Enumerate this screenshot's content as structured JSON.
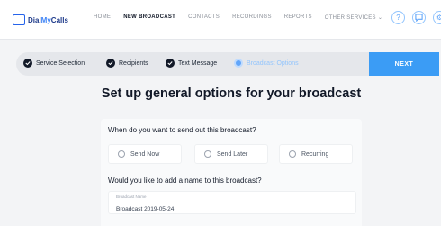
{
  "brand": {
    "logo_text_1": "Dial",
    "logo_text_accent": "My",
    "logo_text_2": "Calls"
  },
  "nav": {
    "items": [
      {
        "label": "HOME"
      },
      {
        "label": "NEW BROADCAST"
      },
      {
        "label": "CONTACTS"
      },
      {
        "label": "RECORDINGS"
      },
      {
        "label": "REPORTS"
      },
      {
        "label": "OTHER SERVICES"
      }
    ],
    "active_index": 1,
    "dropdown_icon": "chevron-down-icon"
  },
  "header_icons": [
    "help-icon",
    "chat-icon",
    "settings-icon"
  ],
  "steps": [
    {
      "label": "Service Selection",
      "state": "done"
    },
    {
      "label": "Recipients",
      "state": "done"
    },
    {
      "label": "Text Message",
      "state": "done"
    },
    {
      "label": "Broadcast Options",
      "state": "current"
    }
  ],
  "next_button": {
    "label": "NEXT"
  },
  "page": {
    "heading": "Set up general options for your broadcast",
    "question_1": "When do you want to send out this broadcast?",
    "send_options": [
      {
        "label": "Send Now"
      },
      {
        "label": "Send Later"
      },
      {
        "label": "Recurring"
      }
    ],
    "question_2": "Would you like to add a name to this broadcast?",
    "name_field": {
      "label": "Broadcast Name",
      "value": "Broadcast 2019-05-24"
    }
  },
  "colors": {
    "accent": "#3b9cf5",
    "step_done": "#111827",
    "step_current": "#60a5fa",
    "background": "#f3f4f6"
  }
}
